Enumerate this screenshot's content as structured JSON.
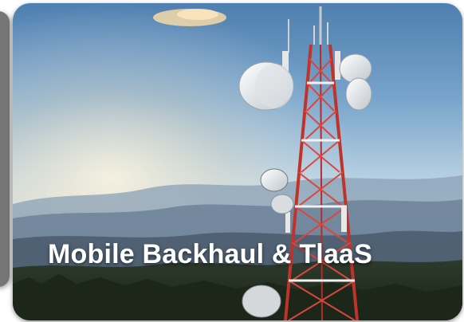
{
  "card": {
    "title": "Mobile Backhaul & TlaaS",
    "image_icon": "cell-tower-photo"
  },
  "colors": {
    "caption_text": "#ffffff",
    "tower_red": "#c0332b",
    "tower_white": "#f2f2f2",
    "side_card": "#767676"
  }
}
